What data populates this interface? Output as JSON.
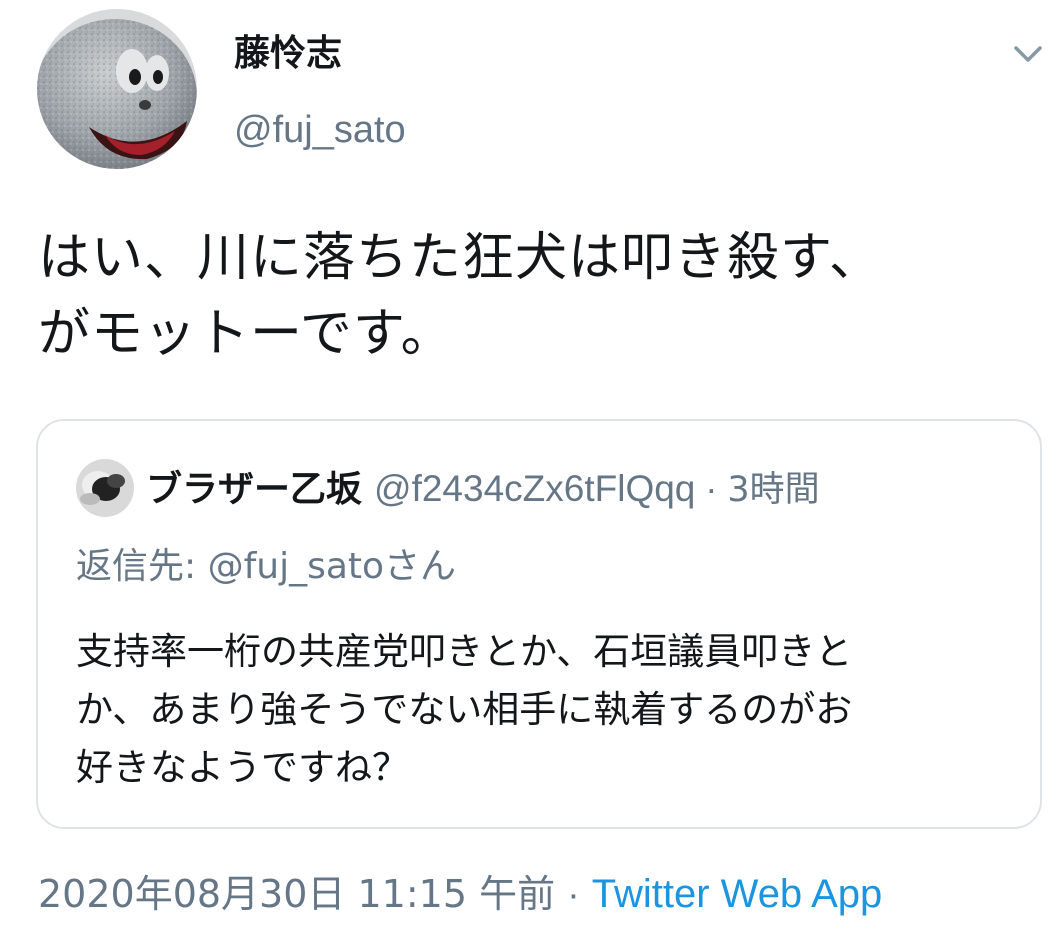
{
  "tweet": {
    "author": {
      "name": "藤怜志",
      "handle": "@fuj_sato",
      "avatar_icon": "stone-face-avatar"
    },
    "caret_icon": "chevron-down-icon",
    "text": "はい、川に落ちた狂犬は叩き殺す、\nがモットーです。",
    "quoted": {
      "author_name": "ブラザー乙坂",
      "author_handle": "@f2434cZx6tFlQqq",
      "separator": "·",
      "time": "3時間",
      "reply_to": "返信先: @fuj_satoさん",
      "text": "支持率一桁の共産党叩きとか、石垣議員叩きと\nか、あまり強そうでない相手に執着するのがお\n好きなようですね？",
      "avatar_icon": "quoted-avatar"
    },
    "timestamp": "2020年08月30日 11:15 午前",
    "meta_separator": "·",
    "source": "Twitter Web App"
  },
  "colors": {
    "text_primary": "#14171a",
    "text_secondary": "#657786",
    "link": "#1b95e0",
    "border": "#dfe4e8"
  }
}
